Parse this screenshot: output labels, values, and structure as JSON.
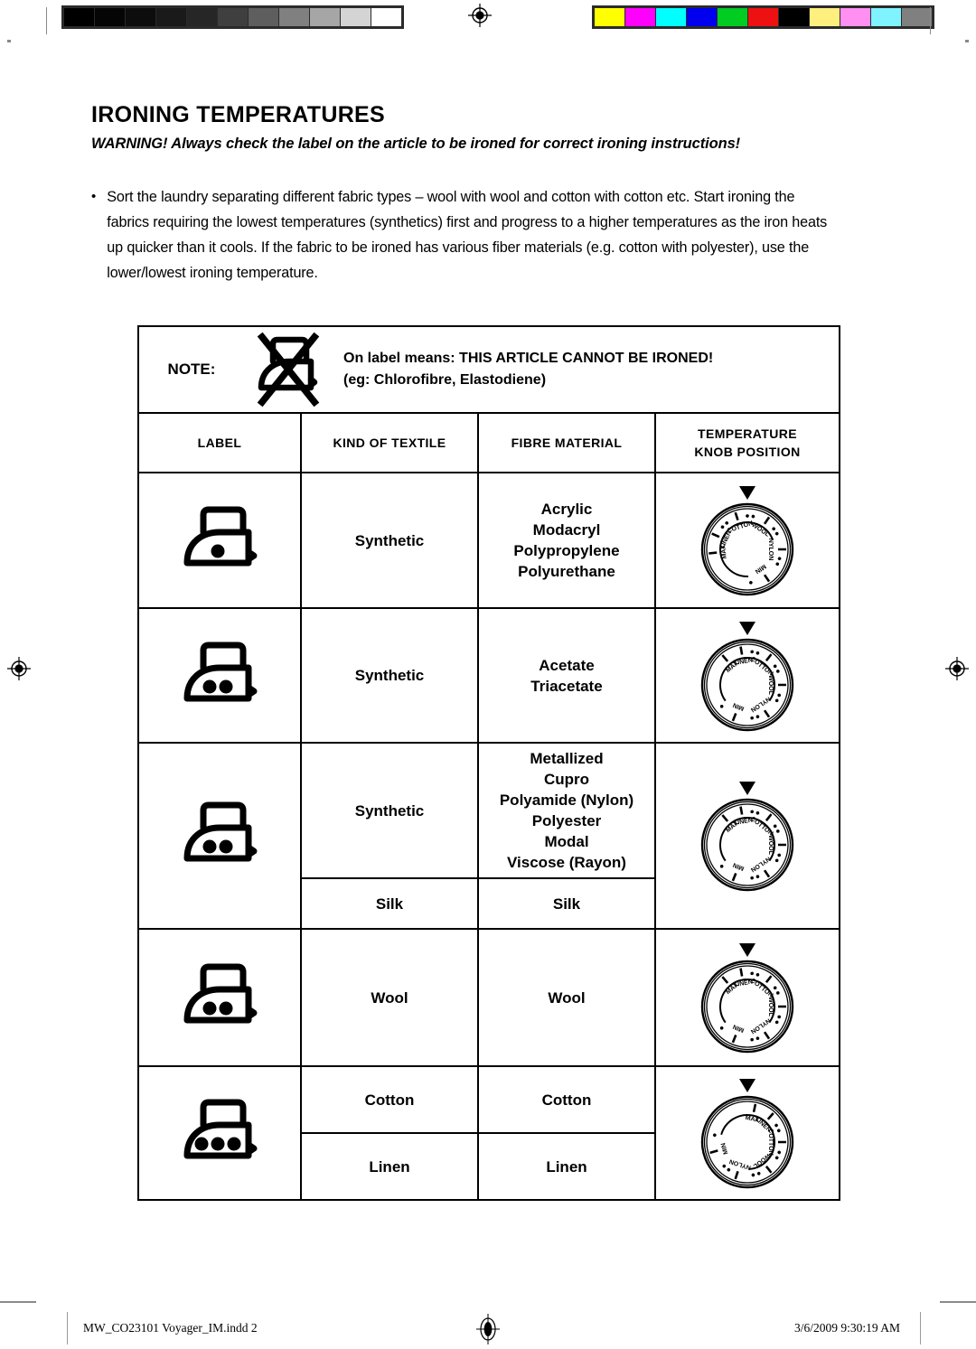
{
  "page": {
    "title": "IRONING TEMPERATURES",
    "warning": "WARNING! Always check the label on the article to be ironed for correct ironing instructions!",
    "bullet_marker": "•",
    "bullet_text": "Sort the laundry separating different fabric types – wool with wool and cotton with cotton etc. Start ironing the fabrics requiring the lowest temperatures (synthetics) first and progress to a higher temperatures as the iron heats up quicker than it cools. If the fabric to be ironed has various fiber materials (e.g. cotton with polyester), use the lower/lowest ironing temperature."
  },
  "note": {
    "label": "NOTE:",
    "symbol_name": "do-not-iron-symbol",
    "line1": "On label means: THIS ARTICLE CANNOT BE IRONED!",
    "line2": "(eg: Chlorofibre, Elastodiene)"
  },
  "table": {
    "headers": [
      "LABEL",
      "KIND OF TEXTILE",
      "FIBRE MATERIAL",
      "TEMPERATURE\nKNOB POSITION"
    ],
    "header_temperature_line1": "TEMPERATURE",
    "header_temperature_line2": "KNOB POSITION",
    "rows": [
      {
        "label_symbol": "iron-1-dot",
        "dots": 1,
        "kind": "Synthetic",
        "fibre": "Acrylic\nModacryl\nPolypropylene\nPolyurethane",
        "fibre_lines": [
          "Acrylic",
          "Modacryl",
          "Polypropylene",
          "Polyurethane"
        ],
        "knob_setting": "NYLON"
      },
      {
        "label_symbol": "iron-2-dot",
        "dots": 2,
        "kind": "Synthetic",
        "fibre": "Acetate\nTriacetate",
        "fibre_lines": [
          "Acetate",
          "Triacetate"
        ],
        "knob_setting": "WOOL"
      },
      {
        "label_symbol": "iron-2-dot",
        "dots": 2,
        "kind": "Synthetic",
        "fibre": "Metallized\nCupro\nPolyamide (Nylon)\nPolyester\nModal\nViscose (Rayon)",
        "fibre_lines": [
          "Metallized",
          "Cupro",
          "Polyamide (Nylon)",
          "Polyester",
          "Modal",
          "Viscose (Rayon)"
        ],
        "sub_kind": "Silk",
        "sub_fibre": "Silk",
        "knob_setting": "WOOL"
      },
      {
        "label_symbol": "iron-2-dot",
        "dots": 2,
        "kind": "Wool",
        "fibre": "Wool",
        "fibre_lines": [
          "Wool"
        ],
        "knob_setting": "WOOL"
      },
      {
        "label_symbol": "iron-3-dot",
        "dots": 3,
        "kind": "Cotton",
        "fibre": "Cotton",
        "fibre_lines": [
          "Cotton"
        ],
        "sub_kind": "Linen",
        "sub_fibre": "Linen",
        "knob_setting": "COTTON"
      }
    ]
  },
  "knob_dial": {
    "tick_labels": [
      "MIN",
      "NYLON",
      "WOOL",
      "COTTON",
      "LINEN",
      "MAX"
    ],
    "pointer_name": "knob-pointer-triangle"
  },
  "print_marks": {
    "gray_bar_name": "grayscale-step-wedge",
    "gray_values": [
      "#000000",
      "#050505",
      "#0d0d0d",
      "#1a1a1a",
      "#262626",
      "#3f3f3f",
      "#5e5e5e",
      "#808080",
      "#a6a6a6",
      "#d4d4d4",
      "#ffffff"
    ],
    "color_bar_name": "process-color-control-bar",
    "color_values": [
      "#ffff00",
      "#ff00ff",
      "#00ffff",
      "#0000ee",
      "#00cc22",
      "#ee1111",
      "#000000",
      "#ffef7f",
      "#ff8ff0",
      "#7ff4ff",
      "#808080"
    ],
    "registration_name": "registration-target"
  },
  "footer": {
    "file": "MW_CO23101 Voyager_IM.indd   2",
    "timestamp": "3/6/2009   9:30:19 AM"
  }
}
